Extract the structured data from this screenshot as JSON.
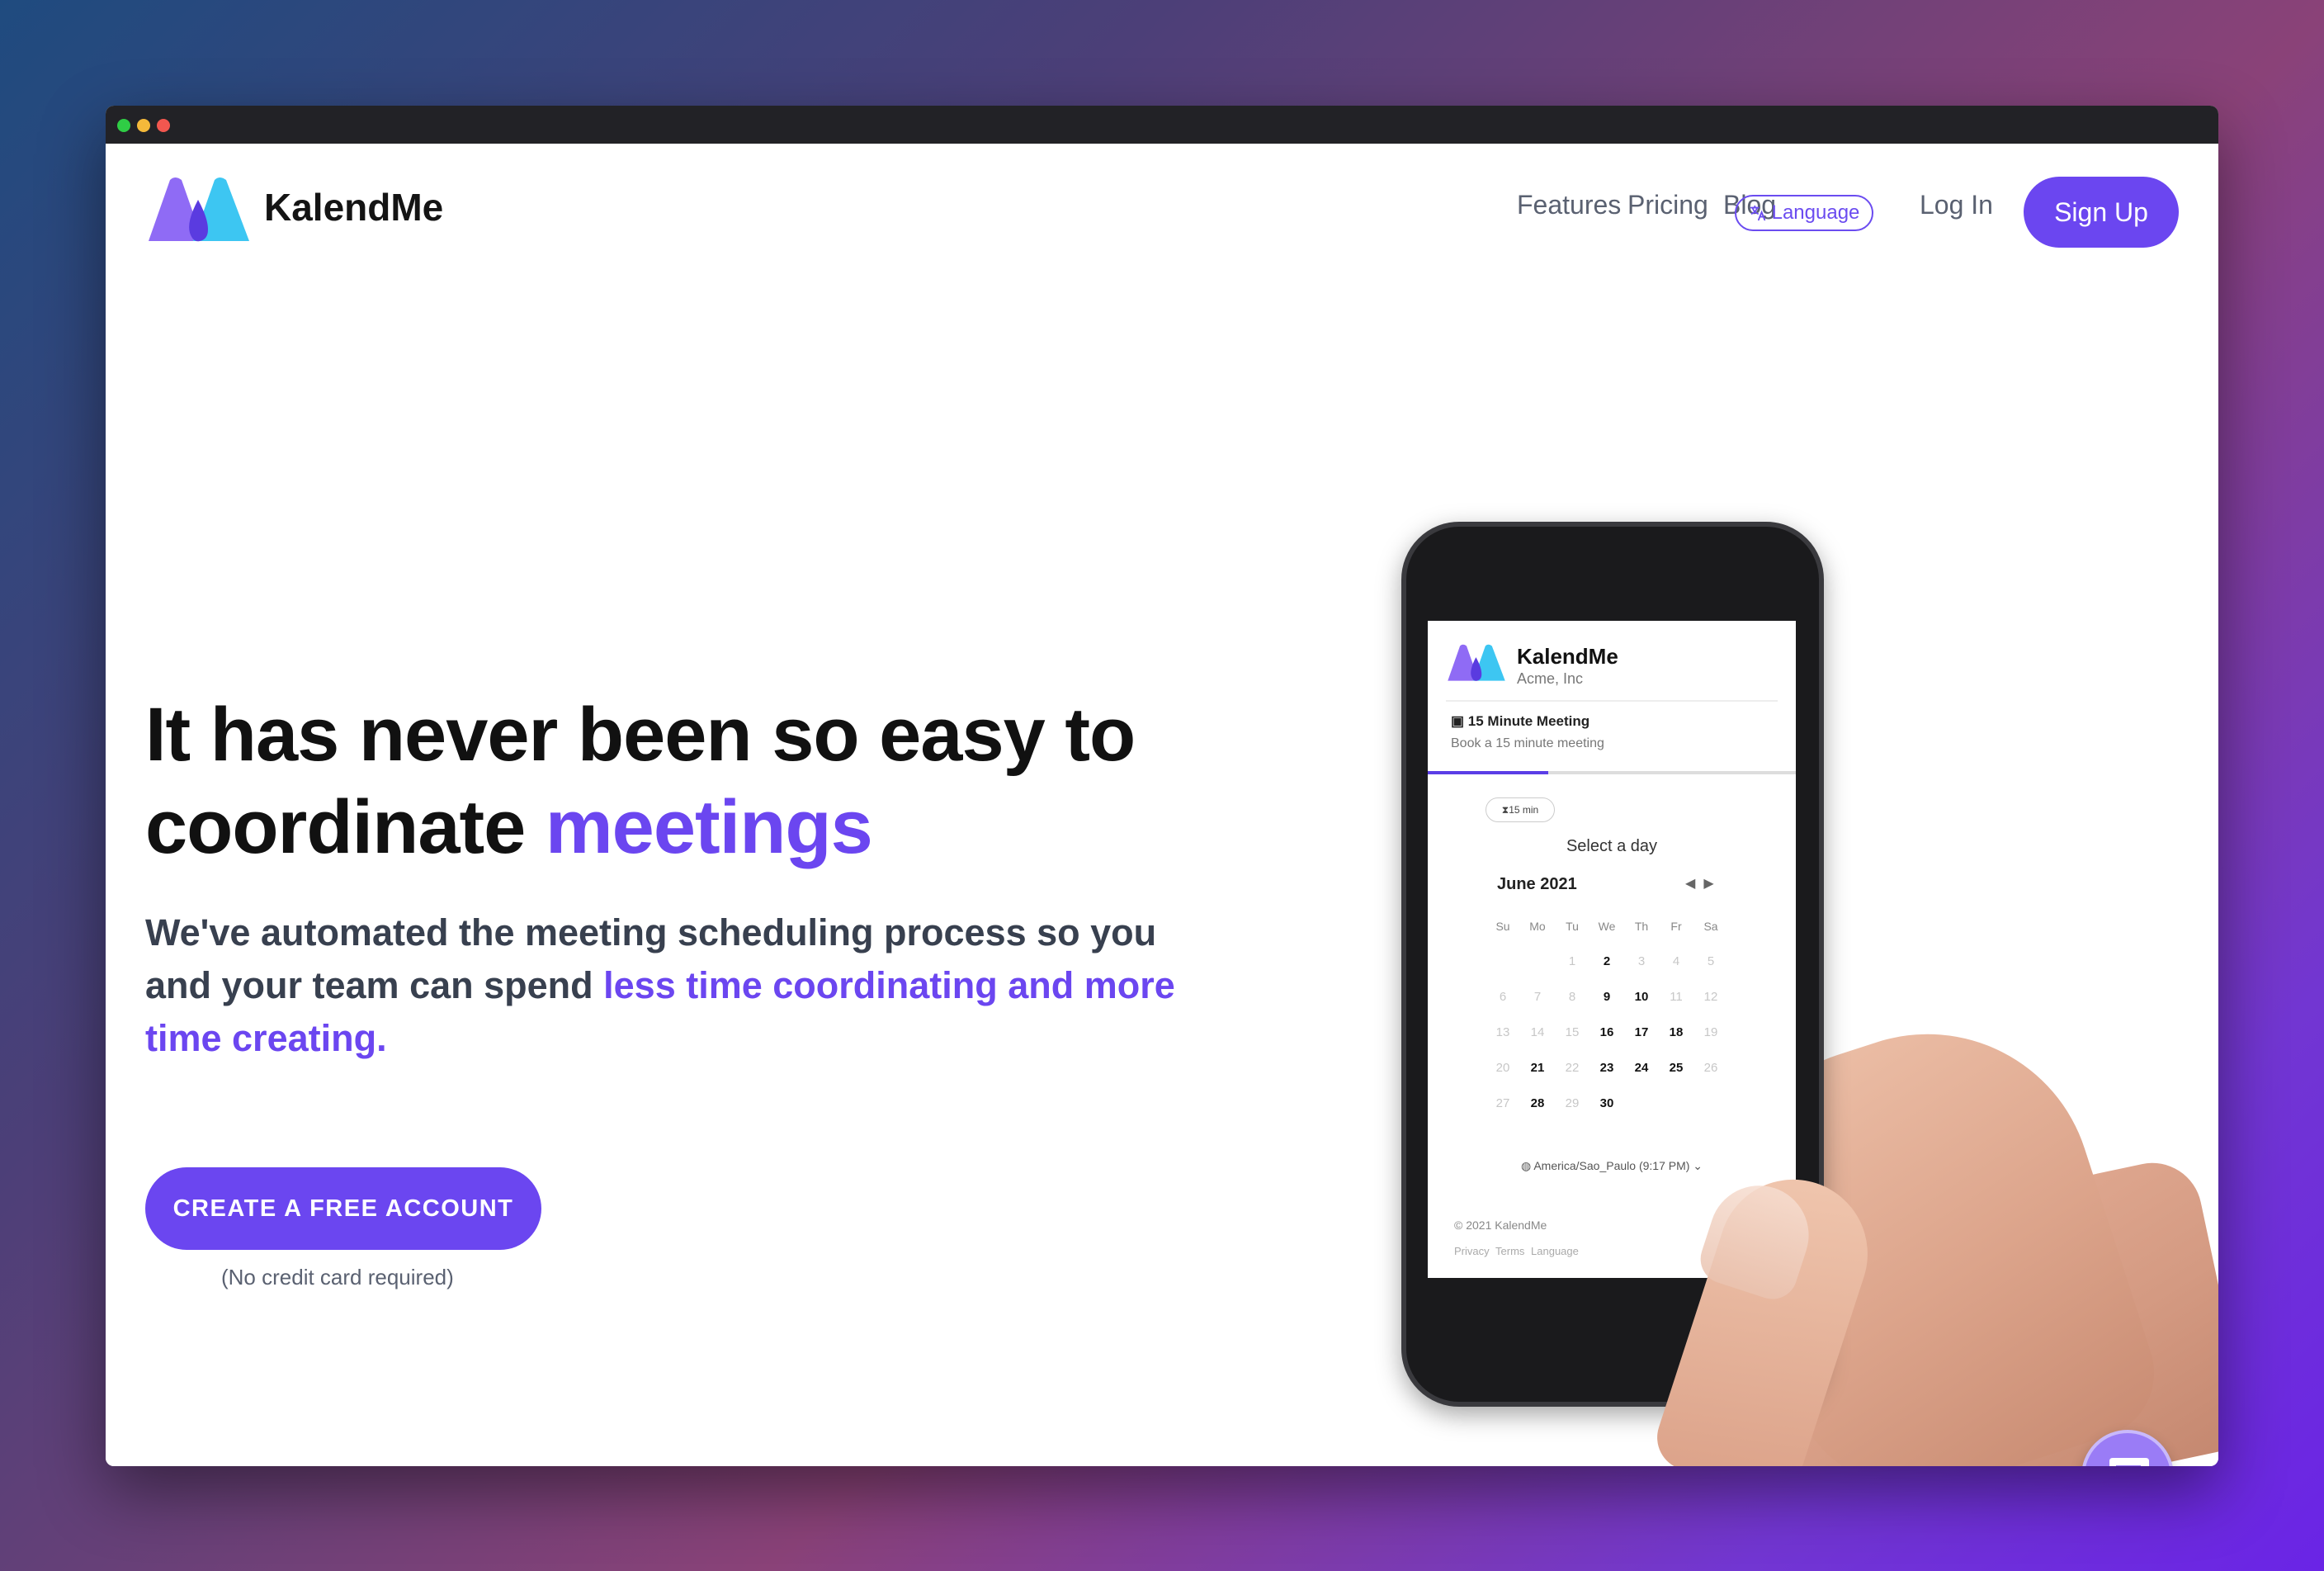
{
  "brand": {
    "name": "KalendMe"
  },
  "nav": {
    "features": "Features",
    "pricing": "Pricing",
    "blog": "Blog",
    "language": "Language",
    "login": "Log In",
    "signup": "Sign Up"
  },
  "hero": {
    "title_part1": "It has never been so easy to coordinate ",
    "title_accent": "meetings",
    "subtitle_part1": "We've automated the meeting scheduling process so you and your team can spend ",
    "subtitle_accent": "less time coordinating and more time creating.",
    "cta": "CREATE A FREE ACCOUNT",
    "cta_note": "(No credit card required)"
  },
  "phone_screen": {
    "brand": "KalendMe",
    "org": "Acme, Inc",
    "meeting_title": "15 Minute Meeting",
    "meeting_subtitle": "Book a 15 minute meeting",
    "duration_pill": "15 min",
    "select_day": "Select a day",
    "month": "June 2021",
    "weekdays": [
      "Su",
      "Mo",
      "Tu",
      "We",
      "Th",
      "Fr",
      "Sa"
    ],
    "weeks": [
      [
        "",
        "",
        "1",
        "2",
        "3",
        "4",
        "5"
      ],
      [
        "6",
        "7",
        "8",
        "9",
        "10",
        "11",
        "12"
      ],
      [
        "13",
        "14",
        "15",
        "16",
        "17",
        "18",
        "19"
      ],
      [
        "20",
        "21",
        "22",
        "23",
        "24",
        "25",
        "26"
      ],
      [
        "27",
        "28",
        "29",
        "30",
        "",
        "",
        ""
      ]
    ],
    "available_days": [
      "2",
      "9",
      "10",
      "16",
      "17",
      "18",
      "21",
      "23",
      "24",
      "25",
      "28",
      "30"
    ],
    "timezone": "America/Sao_Paulo (9:17 PM)",
    "copyright": "© 2021 KalendMe",
    "footer_links": [
      "Privacy",
      "Terms",
      "Language"
    ]
  },
  "icons": {
    "logo": "kalendme-logo",
    "language": "translate-icon",
    "chat": "chat-icon",
    "calendar": "calendar-icon",
    "hourglass": "hourglass-icon",
    "globe": "globe-icon",
    "arrow_left": "arrow-left-icon",
    "arrow_right": "arrow-right-icon"
  },
  "colors": {
    "accent": "#6b46f0",
    "text_dark": "#111111",
    "text_muted": "#5a6171",
    "chat_bubble": "#9a7cf6"
  }
}
